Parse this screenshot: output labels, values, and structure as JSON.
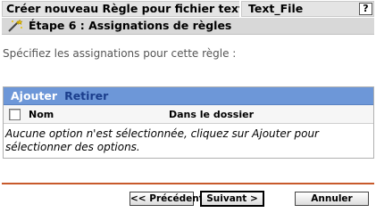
{
  "title": {
    "left": "Créer nouveau Règle pour fichier texte",
    "right": "Text_File",
    "help": "?"
  },
  "step": {
    "icon": "wand-icon",
    "title": "Étape 6 : Assignations de règles"
  },
  "instructions": "Spécifiez les assignations pour cette règle :",
  "assignments": {
    "add_label": "Ajouter",
    "remove_label": "Retirer",
    "columns": [
      "Nom",
      "Dans le dossier"
    ],
    "empty_message": "Aucune option n'est sélectionnée, cliquez sur Ajouter pour sélectionner des options."
  },
  "buttons": {
    "previous": "<< Précédent",
    "next": "Suivant >",
    "cancel": "Annuler"
  },
  "colors": {
    "header_bar": "#6d97d8",
    "separator": "#c85a2b"
  }
}
